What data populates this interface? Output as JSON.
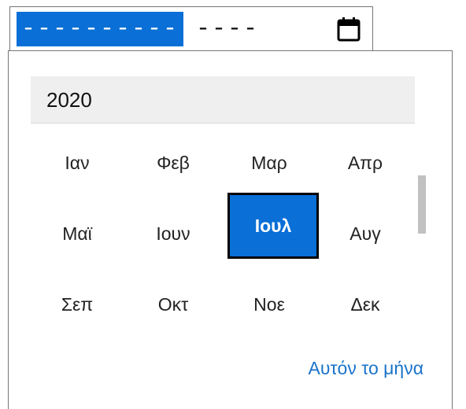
{
  "input": {
    "month_placeholder": "----------",
    "year_placeholder": "----"
  },
  "icons": {
    "calendar": "calendar-icon"
  },
  "picker": {
    "year": "2020",
    "months": [
      "Ιαν",
      "Φεβ",
      "Μαρ",
      "Απρ",
      "Μαϊ",
      "Ιουν",
      "Ιουλ",
      "Αυγ",
      "Σεπ",
      "Οκτ",
      "Νοε",
      "Δεκ"
    ],
    "selected_index": 6,
    "today_label": "Αυτόν το μήνα"
  },
  "colors": {
    "accent": "#0a6fd6",
    "link": "#1a73c9"
  }
}
